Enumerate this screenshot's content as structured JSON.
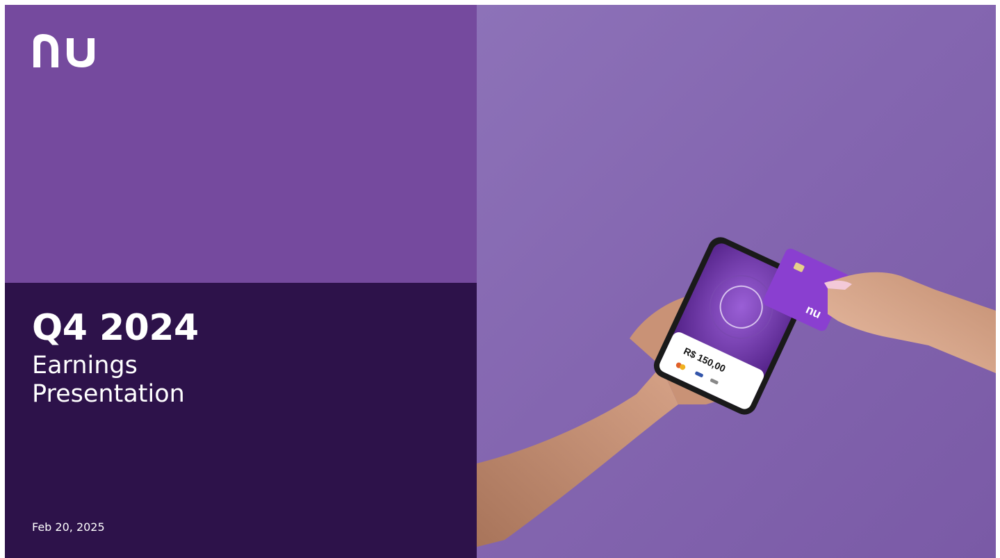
{
  "slide": {
    "title": "Q4 2024",
    "subtitle_line1": "Earnings",
    "subtitle_line2": "Presentation",
    "date": "Feb 20, 2025"
  },
  "brand": {
    "logo_text": "nu",
    "primary_color": "#754a9e",
    "dark_color": "#2d124a",
    "photo_background": "#8466b0"
  },
  "photo": {
    "phone_amount": "R$ 150,00"
  }
}
